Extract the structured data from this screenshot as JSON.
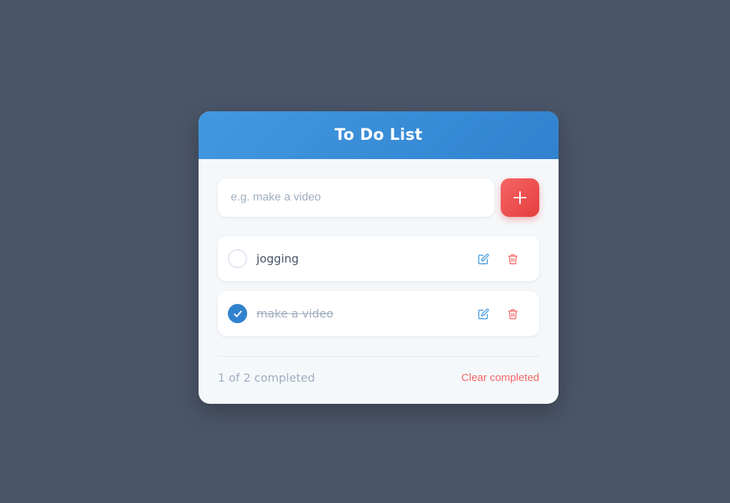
{
  "header": {
    "title": "To Do List"
  },
  "input": {
    "placeholder": "e.g. make a video",
    "value": ""
  },
  "add_button": {
    "icon": "plus-icon"
  },
  "todos": [
    {
      "text": "jogging",
      "completed": false
    },
    {
      "text": "make a video",
      "completed": true
    }
  ],
  "footer": {
    "count_text": "1 of 2 completed",
    "clear_label": "Clear completed"
  },
  "colors": {
    "background": "#4a5568",
    "header": "#4299e1",
    "accent_blue": "#3182ce",
    "accent_red": "#f56565",
    "muted_text": "#a0aec0"
  }
}
